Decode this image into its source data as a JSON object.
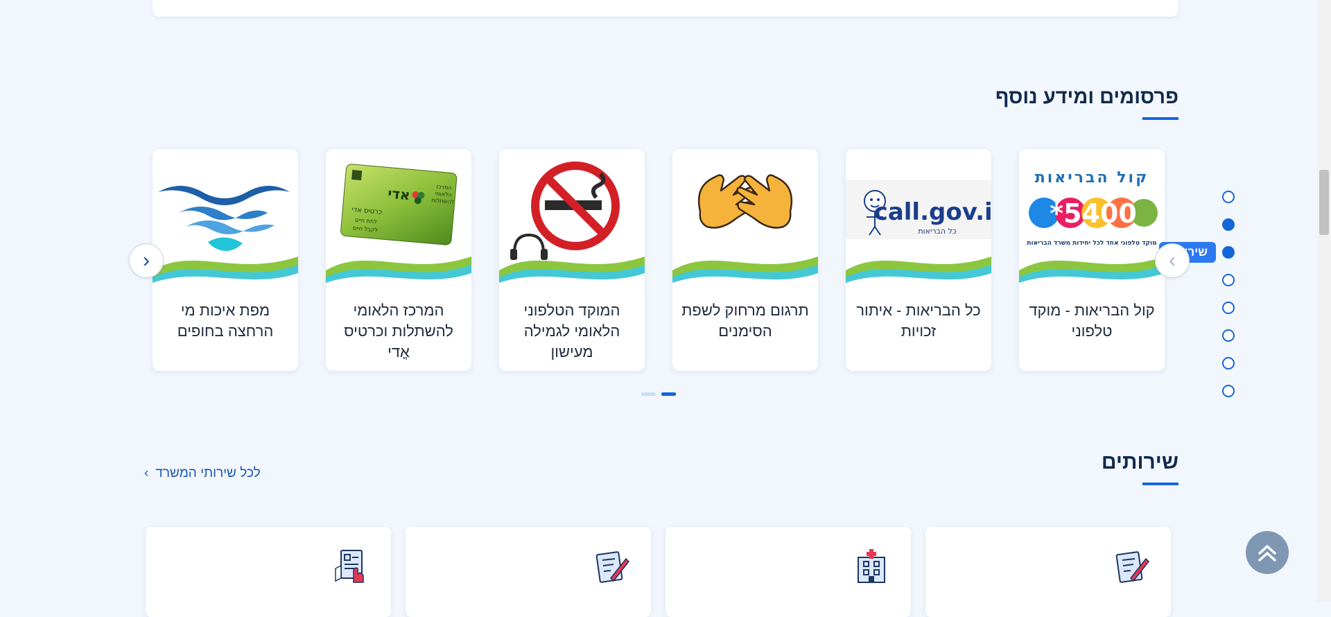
{
  "publications": {
    "title": "פרסומים ומידע נוסף",
    "cards": [
      {
        "label": "קול הבריאות - מוקד טלפוני",
        "image": "kol-habriut-5400-logo"
      },
      {
        "label": "כל הבריאות - איתור זכויות",
        "image": "call-gov-il-logo"
      },
      {
        "label": "תרגום מרחוק לשפת הסימנים",
        "image": "sign-language-hands"
      },
      {
        "label": "המוקד הטלפוני הלאומי לגמילה מעישון",
        "image": "no-smoking-sign"
      },
      {
        "label": "המרכז הלאומי להשתלות וכרטיס אֳדי",
        "image": "adi-donor-card"
      },
      {
        "label": "מפת איכות מי הרחצה בחופים",
        "image": "water-waves-logo"
      }
    ],
    "logo_texts": {
      "kol": "קול הבריאות",
      "number": "*5400",
      "kol_sub": "מוקד טלפוני אחד לכל יחידות משרד הבריאות",
      "call": "call.gov.il",
      "call_sub": "כל הבריאות",
      "adi_title": "אדי",
      "adi_card": "כרטיס אדי",
      "adi_line1": "המרכז",
      "adi_line2": "הלאומי",
      "adi_line3": "להשתלות",
      "adi_bottom1": "לתת חיים",
      "adi_bottom2": "לקבל חיים"
    },
    "prev_arrow": "‹",
    "next_arrow": "›",
    "carousel_pages": 2,
    "carousel_active_page": 2
  },
  "side_nav": {
    "tag_label": "שירו",
    "dots": 8,
    "filled_dots": [
      2,
      3
    ],
    "accent": "#1565d8"
  },
  "services": {
    "title": "שירותים",
    "all_link": "לכל שירותי המשרד",
    "chevron": "›",
    "cards": [
      {
        "icon": "document-pen-icon"
      },
      {
        "icon": "hospital-icon"
      },
      {
        "icon": "document-pen-icon"
      },
      {
        "icon": "form-hand-icon"
      }
    ]
  },
  "colors": {
    "background": "#f2f7fe",
    "primary": "#1565d8",
    "title": "#102a4c"
  }
}
